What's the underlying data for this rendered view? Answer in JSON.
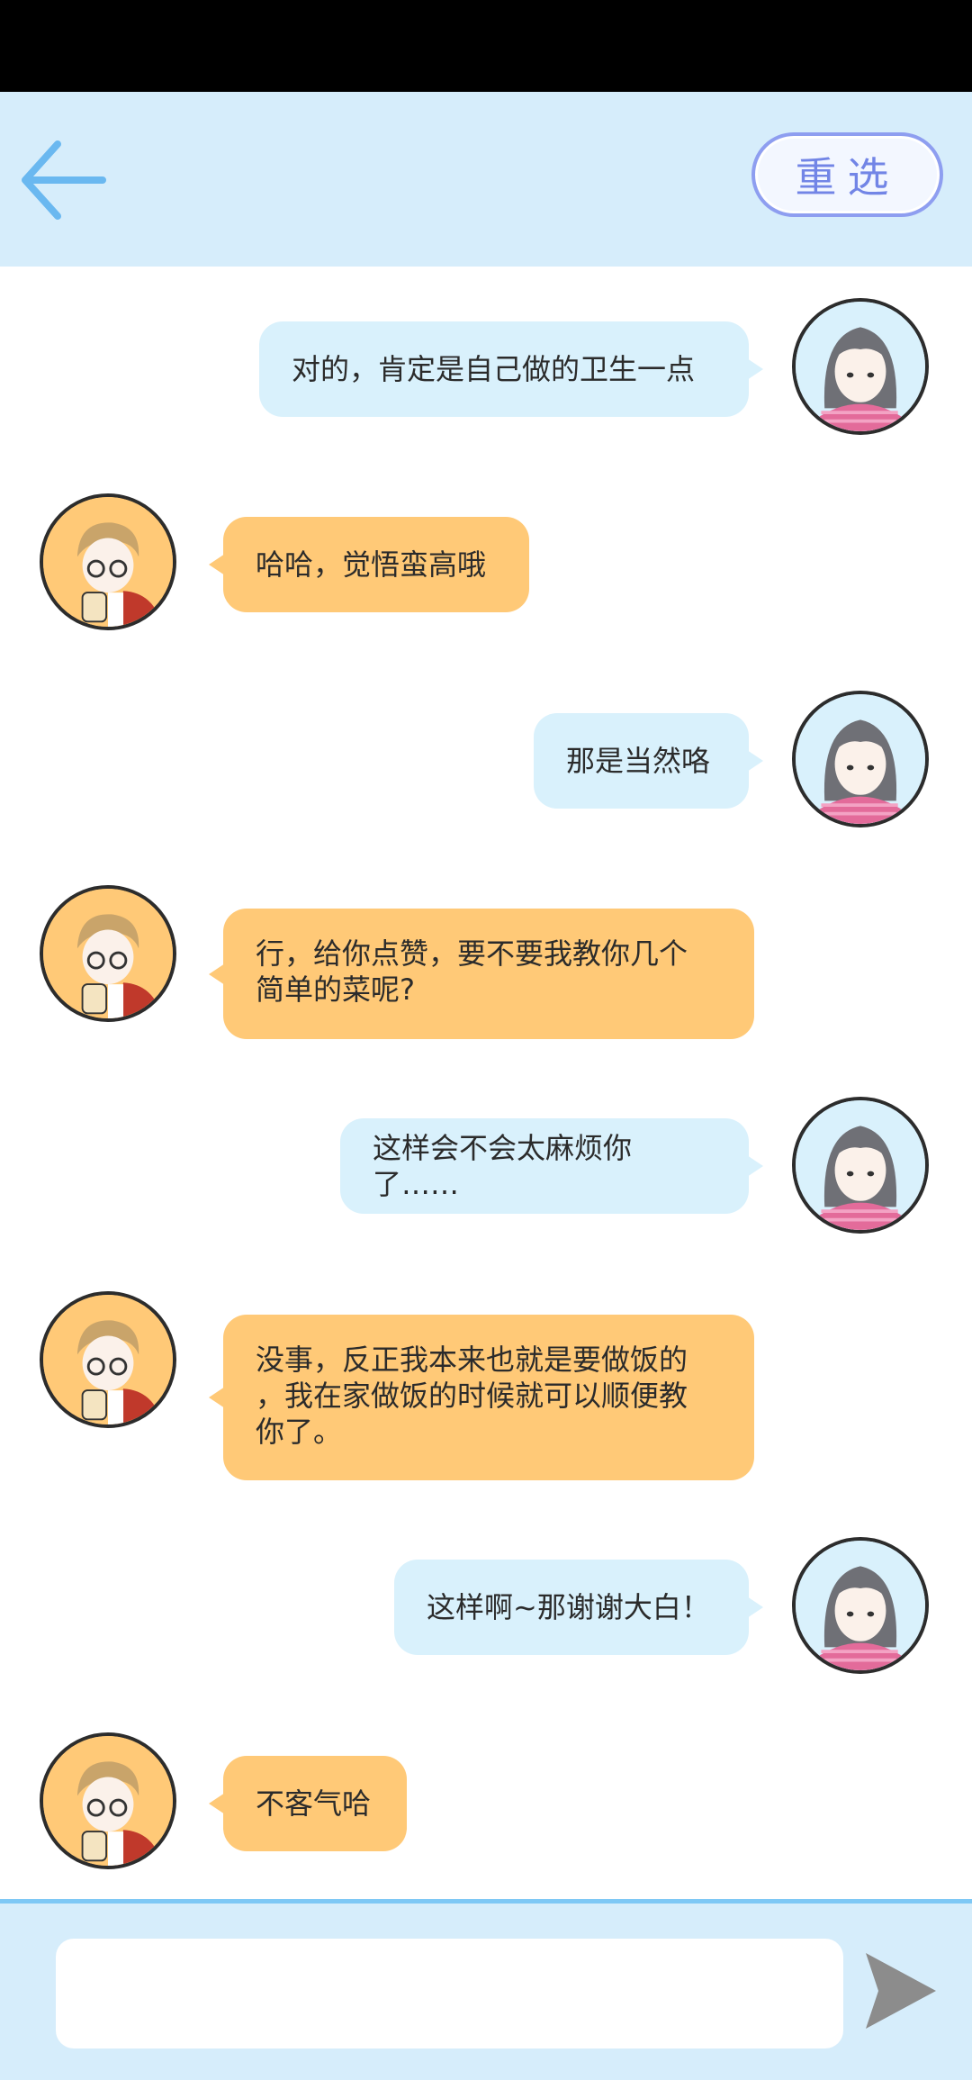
{
  "header": {
    "reselect_label": "重选"
  },
  "messages": [
    {
      "side": "right",
      "text": "对的，肯定是自己做的卫生一点"
    },
    {
      "side": "left",
      "text": "哈哈，觉悟蛮高哦"
    },
    {
      "side": "right",
      "text": "那是当然咯"
    },
    {
      "side": "left",
      "line1": "行，给你点赞，要不要我教你几个",
      "line2": "简单的菜呢?"
    },
    {
      "side": "right",
      "text": "这样会不会太麻烦你了……"
    },
    {
      "side": "left",
      "line1": "没事，反正我本来也就是要做饭的",
      "line2": "，我在家做饭的时候就可以顺便教",
      "line3": "你了。"
    },
    {
      "side": "right",
      "text": "这样啊~那谢谢大白！"
    },
    {
      "side": "left",
      "text": "不客气哈"
    }
  ],
  "composer": {
    "value": "",
    "placeholder": ""
  },
  "icons": {
    "back": "arrow-left-icon",
    "send": "send-arrow-icon"
  },
  "colors": {
    "header_bg": "#d6edfb",
    "right_bubble": "#d9f1fc",
    "left_bubble": "#ffc977",
    "accent_blue": "#6ab8f0"
  }
}
